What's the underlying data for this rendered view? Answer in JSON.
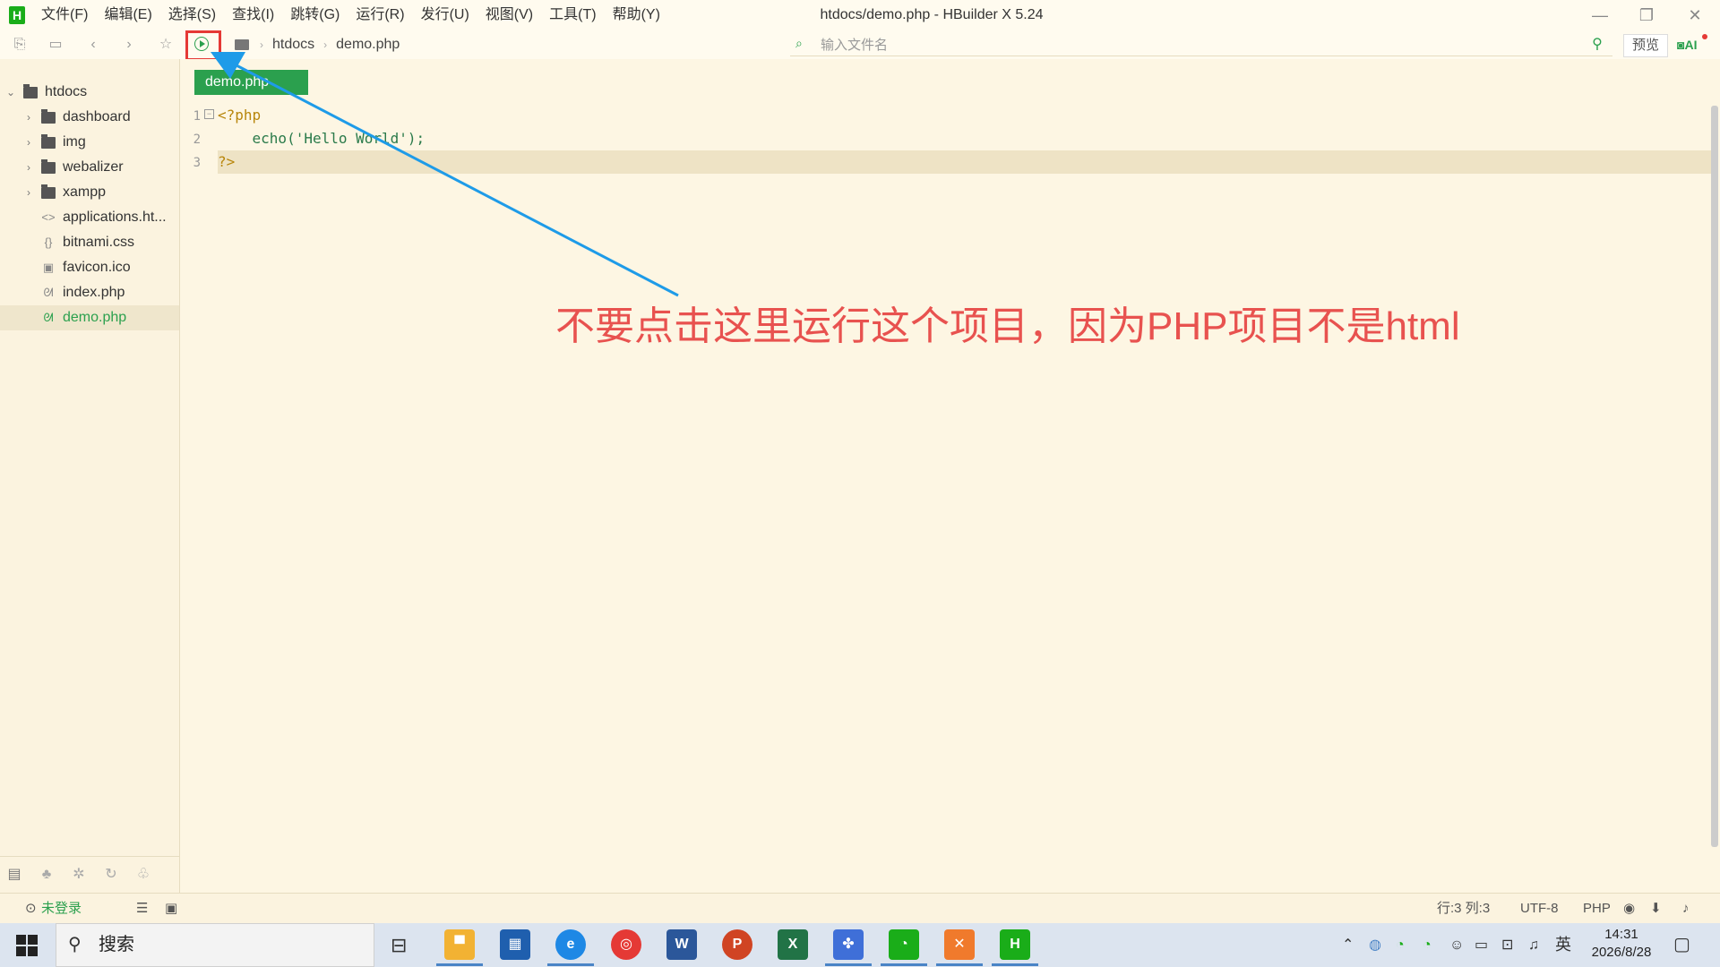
{
  "app": {
    "logo": "H",
    "window_title": "htdocs/demo.php - HBuilder X 5.24",
    "menu": [
      "文件(F)",
      "编辑(E)",
      "选择(S)",
      "查找(I)",
      "跳转(G)",
      "运行(R)",
      "发行(U)",
      "视图(V)",
      "工具(T)",
      "帮助(Y)"
    ]
  },
  "toolbar": {
    "breadcrumb": [
      "htdocs",
      "demo.php"
    ],
    "search_placeholder": "输入文件名",
    "preview_label": "预览",
    "ai_label": "AI"
  },
  "sidebar": {
    "items": [
      {
        "label": "htdocs",
        "type": "root-folder",
        "icon": "folder-icon"
      },
      {
        "label": "dashboard",
        "type": "folder",
        "icon": "folder-icon"
      },
      {
        "label": "img",
        "type": "folder",
        "icon": "folder-icon"
      },
      {
        "label": "webalizer",
        "type": "folder",
        "icon": "folder-icon"
      },
      {
        "label": "xampp",
        "type": "folder",
        "icon": "folder-icon"
      },
      {
        "label": "applications.ht...",
        "type": "file",
        "icon": "html-file-icon"
      },
      {
        "label": "bitnami.css",
        "type": "file",
        "icon": "css-file-icon"
      },
      {
        "label": "favicon.ico",
        "type": "file",
        "icon": "image-file-icon"
      },
      {
        "label": "index.php",
        "type": "file",
        "icon": "php-file-icon"
      },
      {
        "label": "demo.php",
        "type": "file",
        "icon": "php-file-icon",
        "selected": true
      }
    ]
  },
  "editor": {
    "tab_label": "demo.php",
    "lines": [
      {
        "num": "1",
        "text": "<?php"
      },
      {
        "num": "2",
        "text": "    echo('Hello World');"
      },
      {
        "num": "3",
        "text": "?>"
      }
    ],
    "annotation": "不要点击这里运行这个项目，因为PHP项目不是html"
  },
  "statusbar": {
    "login": "未登录",
    "position": "行:3  列:3",
    "encoding": "UTF-8",
    "language": "PHP"
  },
  "taskbar": {
    "search_label": "搜索",
    "ime": "英",
    "time": "14:31",
    "date": "2026/8/28"
  },
  "colors": {
    "accent_green": "#2BA04E",
    "highlight_red": "#E53935",
    "annotation_red": "#E8524F",
    "arrow_blue": "#1E9BE8",
    "editor_bg": "#FDF6E3"
  }
}
